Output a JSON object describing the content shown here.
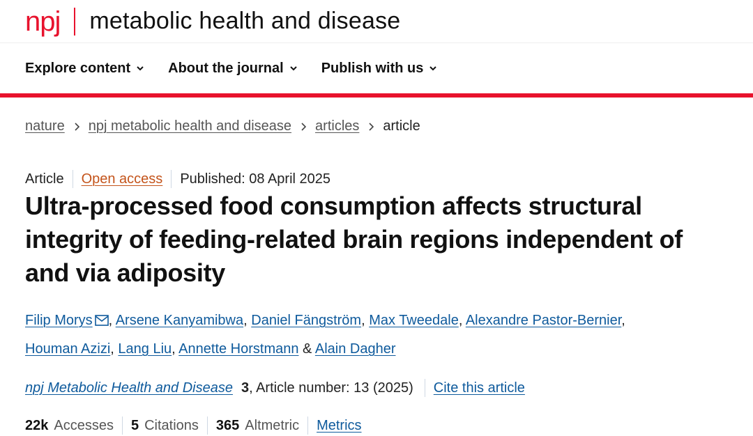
{
  "header": {
    "brand": "npj",
    "title": "metabolic health and disease"
  },
  "nav": {
    "items": [
      {
        "label": "Explore content"
      },
      {
        "label": "About the journal"
      },
      {
        "label": "Publish with us"
      }
    ]
  },
  "breadcrumb": {
    "items": [
      "nature",
      "npj metabolic health and disease",
      "articles"
    ],
    "current": "article"
  },
  "article": {
    "type": "Article",
    "access": "Open access",
    "published": "Published: 08 April 2025",
    "title": "Ultra-processed food consumption affects structural integrity of feeding-related brain regions independent of and via adiposity",
    "authors": [
      "Filip Morys",
      "Arsene Kanyamibwa",
      "Daniel Fängström",
      "Max Tweedale",
      "Alexandre Pastor-Bernier",
      "Houman Azizi",
      "Lang Liu",
      "Annette Horstmann",
      "Alain Dagher"
    ],
    "journal": "npj Metabolic Health and Disease",
    "volume": "3",
    "article_number": ", Article number: 13 (2025)",
    "cite_label": "Cite this article"
  },
  "metrics": {
    "accesses_value": "22k",
    "accesses_label": "Accesses",
    "citations_value": "5",
    "citations_label": "Citations",
    "altmetric_value": "365",
    "altmetric_label": "Altmetric",
    "metrics_link": "Metrics"
  },
  "colors": {
    "brand_red": "#e8122d",
    "link_blue": "#0e5a9c",
    "open_access": "#c4541b"
  }
}
